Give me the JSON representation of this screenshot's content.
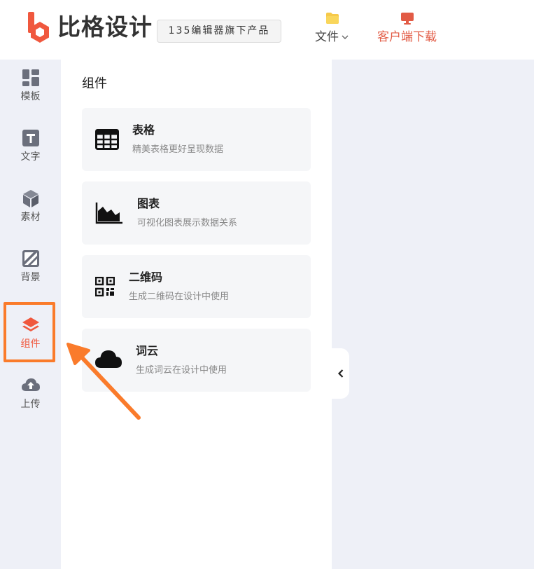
{
  "header": {
    "logo_text": "比格设计",
    "badge": "135编辑器旗下产品",
    "nav": [
      {
        "label": "文件",
        "icon": "folder-icon",
        "has_dropdown": true
      },
      {
        "label": "客户端下载",
        "icon": "monitor-icon"
      }
    ]
  },
  "sidebar": {
    "items": [
      {
        "label": "模板",
        "icon": "grid-icon"
      },
      {
        "label": "文字",
        "icon": "text-icon"
      },
      {
        "label": "素材",
        "icon": "cube-icon"
      },
      {
        "label": "背景",
        "icon": "background-icon"
      },
      {
        "label": "组件",
        "icon": "layers-icon",
        "active": true
      },
      {
        "label": "上传",
        "icon": "cloud-upload-icon"
      }
    ]
  },
  "panel": {
    "title": "组件",
    "cards": [
      {
        "title": "表格",
        "desc": "精美表格更好呈现数据",
        "icon": "table-icon"
      },
      {
        "title": "图表",
        "desc": "可视化图表展示数据关系",
        "icon": "area-chart-icon"
      },
      {
        "title": "二维码",
        "desc": "生成二维码在设计中使用",
        "icon": "qr-code-icon"
      },
      {
        "title": "词云",
        "desc": "生成词云在设计中使用",
        "icon": "cloud-icon"
      }
    ]
  },
  "colors": {
    "accent": "#f0583e",
    "highlight": "#fa7b2b",
    "sidebar_bg": "#eef0f7",
    "card_bg": "#f5f6f8"
  }
}
